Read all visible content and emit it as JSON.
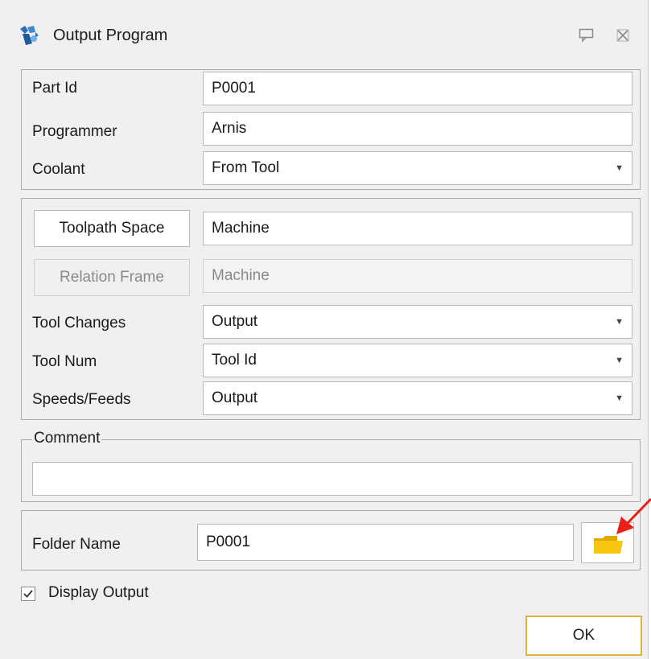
{
  "window": {
    "title": "Output Program",
    "icon": "program-output-icon"
  },
  "titlebar_buttons": {
    "pin_icon": "speech-bubble-pin-icon",
    "close_icon": "close-icon"
  },
  "part": {
    "part_id_label": "Part Id",
    "part_id_value": "P0001",
    "programmer_label": "Programmer",
    "programmer_value": "Arnis",
    "coolant_label": "Coolant",
    "coolant_value": "From Tool"
  },
  "toolpath": {
    "toolpath_space_button": "Toolpath Space",
    "toolpath_space_value": "Machine",
    "relation_frame_button": "Relation Frame",
    "relation_frame_value": "Machine",
    "tool_changes_label": "Tool Changes",
    "tool_changes_value": "Output",
    "tool_num_label": "Tool Num",
    "tool_num_value": "Tool Id",
    "speeds_feeds_label": "Speeds/Feeds",
    "speeds_feeds_value": "Output"
  },
  "comment": {
    "legend": "Comment",
    "value": ""
  },
  "folder": {
    "label": "Folder Name",
    "value": "P0001",
    "browse_icon": "folder-icon"
  },
  "display_output": {
    "label": "Display Output",
    "checked": true
  },
  "footer": {
    "ok_label": "OK"
  },
  "colors": {
    "ok_border": "#e0b240",
    "annotation_arrow": "#e8201a",
    "folder_icon": "#f5c000"
  }
}
